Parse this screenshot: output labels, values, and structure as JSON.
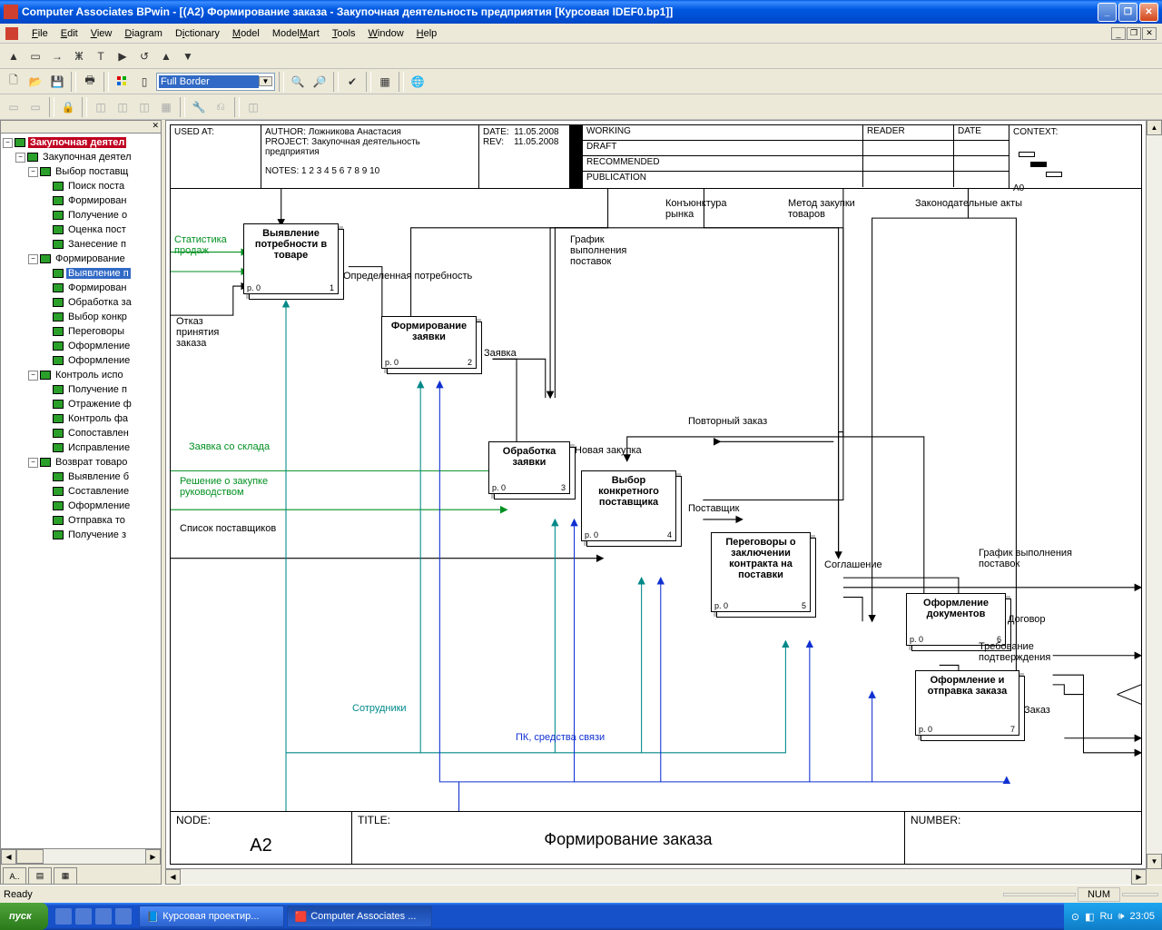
{
  "title": "Computer Associates BPwin - [(A2) Формирование  заказа - Закупочная деятельность предприятия  [Курсовая IDEF0.bp1]]",
  "menu": [
    "File",
    "Edit",
    "View",
    "Diagram",
    "Dictionary",
    "Model",
    "ModelMart",
    "Tools",
    "Window",
    "Help"
  ],
  "combo_value": "Full Border",
  "tree": {
    "root": "Закупочная деятел",
    "n1": "Закупочная деятел",
    "n1_children": {
      "a": "Выбор поставщ",
      "a_children": [
        "Поиск поста",
        "Формирован",
        "Получение о",
        "Оценка пост",
        "Занесение п"
      ],
      "b": "Формирование",
      "b_children": [
        "Выявление п",
        "Формирован",
        "Обработка за",
        "Выбор конкр",
        "Переговоры",
        "Оформление",
        "Оформление"
      ],
      "c": "Контроль испо",
      "c_children": [
        "Получение п",
        "Отражение ф",
        "Контроль фа",
        "Сопоставлен",
        "Исправление"
      ],
      "d": "Возврат товаро",
      "d_children": [
        "Выявление б",
        "Составление",
        "Оформление",
        "Отправка то",
        "Получение з"
      ]
    }
  },
  "header": {
    "used_at": "USED AT:",
    "author_label": "AUTHOR:",
    "author": "Ложникова Анастасия",
    "project_label": "PROJECT:",
    "project": "Закупочная деятельность предприятия",
    "notes_label": "NOTES:",
    "notes": "1  2  3  4  5  6  7  8  9  10",
    "date_label": "DATE:",
    "date": "11.05.2008",
    "rev_label": "REV:",
    "rev": "11.05.2008",
    "rows": [
      "WORKING",
      "DRAFT",
      "RECOMMENDED",
      "PUBLICATION"
    ],
    "reader": "READER",
    "reader_date": "DATE",
    "context": "CONTEXT:",
    "context_id": "A0"
  },
  "footer": {
    "node_label": "NODE:",
    "node": "A2",
    "title_label": "TITLE:",
    "title": "Формирование  заказа",
    "number_label": "NUMBER:"
  },
  "activities": [
    {
      "id": 1,
      "title": "Выявление потребности в товаре",
      "p": "p. 0"
    },
    {
      "id": 2,
      "title": "Формирование заявки",
      "p": "p. 0"
    },
    {
      "id": 3,
      "title": "Обработка заявки",
      "p": "p. 0"
    },
    {
      "id": 4,
      "title": "Выбор конкретного поставщика",
      "p": "p. 0"
    },
    {
      "id": 5,
      "title": "Переговоры о заключении контракта на поставки",
      "p": "p. 0"
    },
    {
      "id": 6,
      "title": "Оформление документов",
      "p": "p. 0"
    },
    {
      "id": 7,
      "title": "Оформление и отправка заказа",
      "p": "p. 0"
    }
  ],
  "labels": {
    "stat_sales": "Статистика продаж",
    "refusal": "Отказ принятия заказа",
    "need": "Определенная потребность",
    "request": "Заявка",
    "schedule": "График выполнения поставок",
    "market": "Конъюнктура рынка",
    "method": "Метод закупки товаров",
    "laws": "Законодательные акты",
    "warehouse": "Заявка со склада",
    "decision": "Решение о закупке руководством",
    "suppliers": "Список поставщиков",
    "new_purchase": "Новая закупка",
    "repeat": "Повторный заказ",
    "supplier": "Поставщик",
    "agreement": "Соглашение",
    "contract": "Договор",
    "confirm": "Требование подтверждения",
    "order": "Заказ",
    "schedule_out": "График выполнения поставок",
    "staff": "Сотрудники",
    "pc": "ПК, средства связи"
  },
  "status": {
    "ready": "Ready",
    "num": "NUM"
  },
  "taskbar": {
    "start": "пуск",
    "task1": "Курсовая проектир...",
    "task2": "Computer Associates ...",
    "lang": "Ru",
    "time": "23:05"
  }
}
